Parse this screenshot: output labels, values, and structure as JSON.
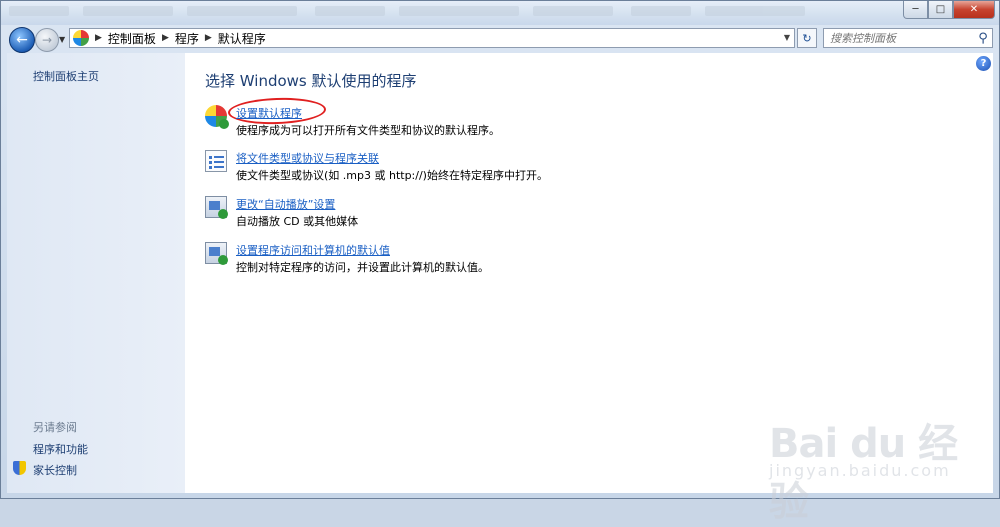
{
  "window": {
    "caption_buttons": {
      "minimize": "─",
      "maximize": "□",
      "close": "✕"
    }
  },
  "navigation": {
    "back_glyph": "←",
    "forward_glyph": "→",
    "breadcrumb": [
      "控制面板",
      "程序",
      "默认程序"
    ],
    "refresh_glyph": "↻",
    "search_placeholder": "搜索控制面板"
  },
  "sidebar": {
    "home_link": "控制面板主页",
    "see_also_heading": "另请参阅",
    "links": [
      "程序和功能",
      "家长控制"
    ]
  },
  "main": {
    "title": "选择 Windows 默认使用的程序",
    "help_glyph": "?",
    "tasks": [
      {
        "icon": "default-programs-icon",
        "link": "设置默认程序",
        "description": "使程序成为可以打开所有文件类型和协议的默认程序。",
        "highlighted": true
      },
      {
        "icon": "file-association-icon",
        "link": "将文件类型或协议与程序关联",
        "description": "使文件类型或协议(如 .mp3 或 http://)始终在特定程序中打开。",
        "highlighted": false
      },
      {
        "icon": "autoplay-icon",
        "link": "更改“自动播放”设置",
        "description": "自动播放 CD 或其他媒体",
        "highlighted": false
      },
      {
        "icon": "program-access-icon",
        "link": "设置程序访问和计算机的默认值",
        "description": "控制对特定程序的访问，并设置此计算机的默认值。",
        "highlighted": false
      }
    ]
  },
  "watermark": {
    "brand": "Bai du 经验",
    "url": "jingyan.baidu.com"
  },
  "colors": {
    "link": "#1a5fc4",
    "title": "#1e3f73",
    "highlight": "#e02020"
  }
}
